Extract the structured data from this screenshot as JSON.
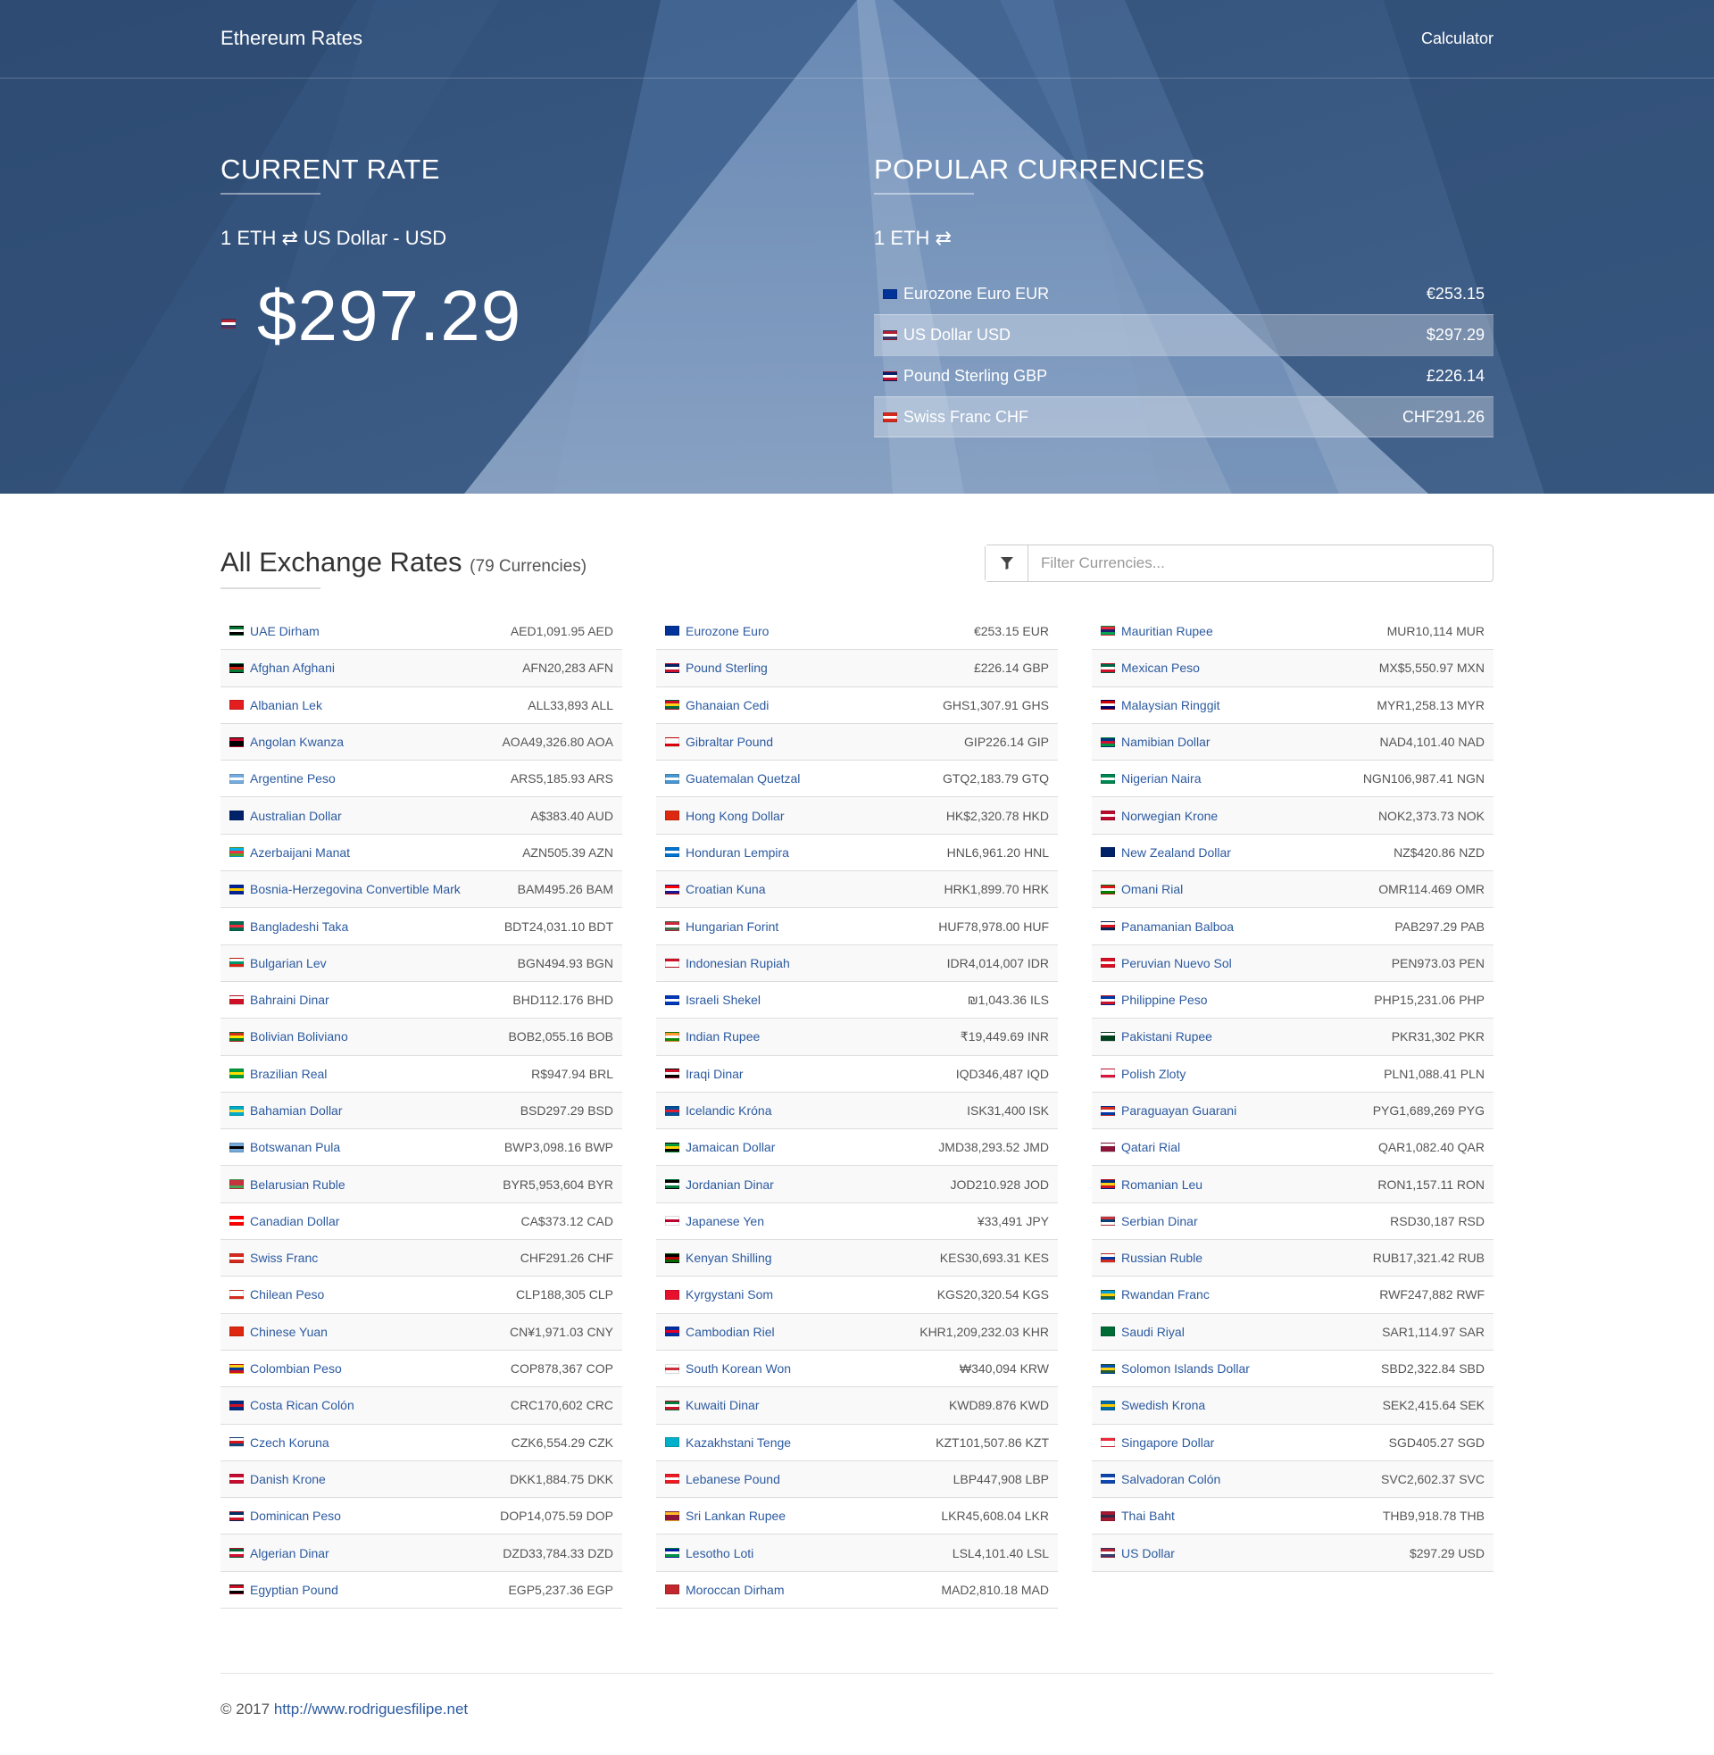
{
  "nav": {
    "brand": "Ethereum Rates",
    "calculator_link": "Calculator"
  },
  "current": {
    "title": "CURRENT RATE",
    "pair": "1 ETH ⇄ US Dollar - USD",
    "rate": "$297.29"
  },
  "popular": {
    "title": "POPULAR CURRENCIES",
    "pair": "1 ETH ⇄",
    "rows": [
      {
        "name": "Eurozone Euro EUR",
        "value": "€253.15",
        "flag": "eu"
      },
      {
        "name": "US Dollar USD",
        "value": "$297.29",
        "flag": "us"
      },
      {
        "name": "Pound Sterling GBP",
        "value": "£226.14",
        "flag": "gb"
      },
      {
        "name": "Swiss Franc CHF",
        "value": "CHF291.26",
        "flag": "ch"
      }
    ]
  },
  "rates": {
    "title": "All Exchange Rates",
    "count": "(79 Currencies)",
    "filter_placeholder": "Filter Currencies...",
    "columns": [
      [
        {
          "name": "UAE Dirham",
          "value": "AED1,091.95 AED",
          "flag": "ae"
        },
        {
          "name": "Afghan Afghani",
          "value": "AFN20,283 AFN",
          "flag": "af"
        },
        {
          "name": "Albanian Lek",
          "value": "ALL33,893 ALL",
          "flag": "al"
        },
        {
          "name": "Angolan Kwanza",
          "value": "AOA49,326.80 AOA",
          "flag": "ao"
        },
        {
          "name": "Argentine Peso",
          "value": "ARS5,185.93 ARS",
          "flag": "ar"
        },
        {
          "name": "Australian Dollar",
          "value": "A$383.40 AUD",
          "flag": "au"
        },
        {
          "name": "Azerbaijani Manat",
          "value": "AZN505.39 AZN",
          "flag": "az"
        },
        {
          "name": "Bosnia-Herzegovina Convertible Mark",
          "value": "BAM495.26 BAM",
          "flag": "ba"
        },
        {
          "name": "Bangladeshi Taka",
          "value": "BDT24,031.10 BDT",
          "flag": "bd"
        },
        {
          "name": "Bulgarian Lev",
          "value": "BGN494.93 BGN",
          "flag": "bg"
        },
        {
          "name": "Bahraini Dinar",
          "value": "BHD112.176 BHD",
          "flag": "bh"
        },
        {
          "name": "Bolivian Boliviano",
          "value": "BOB2,055.16 BOB",
          "flag": "bo"
        },
        {
          "name": "Brazilian Real",
          "value": "R$947.94 BRL",
          "flag": "br"
        },
        {
          "name": "Bahamian Dollar",
          "value": "BSD297.29 BSD",
          "flag": "bs"
        },
        {
          "name": "Botswanan Pula",
          "value": "BWP3,098.16 BWP",
          "flag": "bw"
        },
        {
          "name": "Belarusian Ruble",
          "value": "BYR5,953,604 BYR",
          "flag": "by"
        },
        {
          "name": "Canadian Dollar",
          "value": "CA$373.12 CAD",
          "flag": "ca"
        },
        {
          "name": "Swiss Franc",
          "value": "CHF291.26 CHF",
          "flag": "ch"
        },
        {
          "name": "Chilean Peso",
          "value": "CLP188,305 CLP",
          "flag": "cl"
        },
        {
          "name": "Chinese Yuan",
          "value": "CN¥1,971.03 CNY",
          "flag": "cn"
        },
        {
          "name": "Colombian Peso",
          "value": "COP878,367 COP",
          "flag": "co"
        },
        {
          "name": "Costa Rican Colón",
          "value": "CRC170,602 CRC",
          "flag": "cr"
        },
        {
          "name": "Czech Koruna",
          "value": "CZK6,554.29 CZK",
          "flag": "cz"
        },
        {
          "name": "Danish Krone",
          "value": "DKK1,884.75 DKK",
          "flag": "dk"
        },
        {
          "name": "Dominican Peso",
          "value": "DOP14,075.59 DOP",
          "flag": "do"
        },
        {
          "name": "Algerian Dinar",
          "value": "DZD33,784.33 DZD",
          "flag": "dz"
        },
        {
          "name": "Egyptian Pound",
          "value": "EGP5,237.36 EGP",
          "flag": "eg"
        }
      ],
      [
        {
          "name": "Eurozone Euro",
          "value": "€253.15 EUR",
          "flag": "eu"
        },
        {
          "name": "Pound Sterling",
          "value": "£226.14 GBP",
          "flag": "gb"
        },
        {
          "name": "Ghanaian Cedi",
          "value": "GHS1,307.91 GHS",
          "flag": "gh"
        },
        {
          "name": "Gibraltar Pound",
          "value": "GIP226.14 GIP",
          "flag": "gi"
        },
        {
          "name": "Guatemalan Quetzal",
          "value": "GTQ2,183.79 GTQ",
          "flag": "gt"
        },
        {
          "name": "Hong Kong Dollar",
          "value": "HK$2,320.78 HKD",
          "flag": "hk"
        },
        {
          "name": "Honduran Lempira",
          "value": "HNL6,961.20 HNL",
          "flag": "hn"
        },
        {
          "name": "Croatian Kuna",
          "value": "HRK1,899.70 HRK",
          "flag": "hr"
        },
        {
          "name": "Hungarian Forint",
          "value": "HUF78,978.00 HUF",
          "flag": "hu"
        },
        {
          "name": "Indonesian Rupiah",
          "value": "IDR4,014,007 IDR",
          "flag": "id"
        },
        {
          "name": "Israeli Shekel",
          "value": "₪1,043.36 ILS",
          "flag": "il"
        },
        {
          "name": "Indian Rupee",
          "value": "₹19,449.69 INR",
          "flag": "in"
        },
        {
          "name": "Iraqi Dinar",
          "value": "IQD346,487 IQD",
          "flag": "iq"
        },
        {
          "name": "Icelandic Króna",
          "value": "ISK31,400 ISK",
          "flag": "is"
        },
        {
          "name": "Jamaican Dollar",
          "value": "JMD38,293.52 JMD",
          "flag": "jm"
        },
        {
          "name": "Jordanian Dinar",
          "value": "JOD210.928 JOD",
          "flag": "jo"
        },
        {
          "name": "Japanese Yen",
          "value": "¥33,491 JPY",
          "flag": "jp"
        },
        {
          "name": "Kenyan Shilling",
          "value": "KES30,693.31 KES",
          "flag": "ke"
        },
        {
          "name": "Kyrgystani Som",
          "value": "KGS20,320.54 KGS",
          "flag": "kg"
        },
        {
          "name": "Cambodian Riel",
          "value": "KHR1,209,232.03 KHR",
          "flag": "kh"
        },
        {
          "name": "South Korean Won",
          "value": "₩340,094 KRW",
          "flag": "kr"
        },
        {
          "name": "Kuwaiti Dinar",
          "value": "KWD89.876 KWD",
          "flag": "kw"
        },
        {
          "name": "Kazakhstani Tenge",
          "value": "KZT101,507.86 KZT",
          "flag": "kz"
        },
        {
          "name": "Lebanese Pound",
          "value": "LBP447,908 LBP",
          "flag": "lb"
        },
        {
          "name": "Sri Lankan Rupee",
          "value": "LKR45,608.04 LKR",
          "flag": "lk"
        },
        {
          "name": "Lesotho Loti",
          "value": "LSL4,101.40 LSL",
          "flag": "ls"
        },
        {
          "name": "Moroccan Dirham",
          "value": "MAD2,810.18 MAD",
          "flag": "ma"
        }
      ],
      [
        {
          "name": "Mauritian Rupee",
          "value": "MUR10,114 MUR",
          "flag": "mu"
        },
        {
          "name": "Mexican Peso",
          "value": "MX$5,550.97 MXN",
          "flag": "mx"
        },
        {
          "name": "Malaysian Ringgit",
          "value": "MYR1,258.13 MYR",
          "flag": "my"
        },
        {
          "name": "Namibian Dollar",
          "value": "NAD4,101.40 NAD",
          "flag": "na"
        },
        {
          "name": "Nigerian Naira",
          "value": "NGN106,987.41 NGN",
          "flag": "ng"
        },
        {
          "name": "Norwegian Krone",
          "value": "NOK2,373.73 NOK",
          "flag": "no"
        },
        {
          "name": "New Zealand Dollar",
          "value": "NZ$420.86 NZD",
          "flag": "nz"
        },
        {
          "name": "Omani Rial",
          "value": "OMR114.469 OMR",
          "flag": "om"
        },
        {
          "name": "Panamanian Balboa",
          "value": "PAB297.29 PAB",
          "flag": "pa"
        },
        {
          "name": "Peruvian Nuevo Sol",
          "value": "PEN973.03 PEN",
          "flag": "pe"
        },
        {
          "name": "Philippine Peso",
          "value": "PHP15,231.06 PHP",
          "flag": "ph"
        },
        {
          "name": "Pakistani Rupee",
          "value": "PKR31,302 PKR",
          "flag": "pk"
        },
        {
          "name": "Polish Zloty",
          "value": "PLN1,088.41 PLN",
          "flag": "pl"
        },
        {
          "name": "Paraguayan Guarani",
          "value": "PYG1,689,269 PYG",
          "flag": "py"
        },
        {
          "name": "Qatari Rial",
          "value": "QAR1,082.40 QAR",
          "flag": "qa"
        },
        {
          "name": "Romanian Leu",
          "value": "RON1,157.11 RON",
          "flag": "ro"
        },
        {
          "name": "Serbian Dinar",
          "value": "RSD30,187 RSD",
          "flag": "rs"
        },
        {
          "name": "Russian Ruble",
          "value": "RUB17,321.42 RUB",
          "flag": "ru"
        },
        {
          "name": "Rwandan Franc",
          "value": "RWF247,882 RWF",
          "flag": "rw"
        },
        {
          "name": "Saudi Riyal",
          "value": "SAR1,114.97 SAR",
          "flag": "sa"
        },
        {
          "name": "Solomon Islands Dollar",
          "value": "SBD2,322.84 SBD",
          "flag": "sb"
        },
        {
          "name": "Swedish Krona",
          "value": "SEK2,415.64 SEK",
          "flag": "se"
        },
        {
          "name": "Singapore Dollar",
          "value": "SGD405.27 SGD",
          "flag": "sg"
        },
        {
          "name": "Salvadoran Colón",
          "value": "SVC2,602.37 SVC",
          "flag": "sv"
        },
        {
          "name": "Thai Baht",
          "value": "THB9,918.78 THB",
          "flag": "th"
        },
        {
          "name": "US Dollar",
          "value": "$297.29 USD",
          "flag": "us"
        }
      ]
    ]
  },
  "footer": {
    "copyright": "© 2017",
    "link": "http://www.rodriguesfilipe.net"
  }
}
